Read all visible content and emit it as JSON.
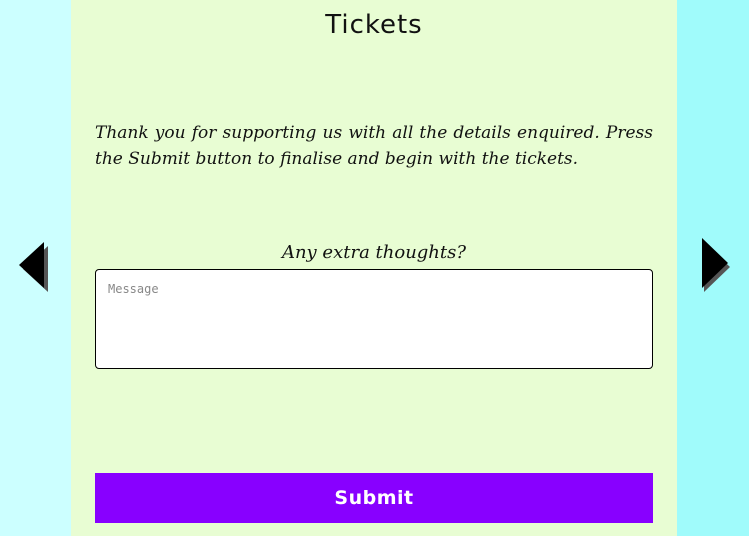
{
  "page": {
    "title": "Tickets",
    "intro_text": "Thank you for supporting us with all the details enquired. Press the Submit button to finalise and begin with the tickets."
  },
  "form": {
    "field_label": "Any extra thoughts?",
    "message_placeholder": "Message",
    "message_value": "",
    "submit_label": "Submit"
  },
  "navigation": {
    "prev_icon": "triangle-left-icon",
    "next_icon": "triangle-right-icon"
  },
  "colors": {
    "page_background": "#ccffff",
    "panel_background": "#e8fdd3",
    "accent": "#8800ff",
    "text": "#111111"
  }
}
